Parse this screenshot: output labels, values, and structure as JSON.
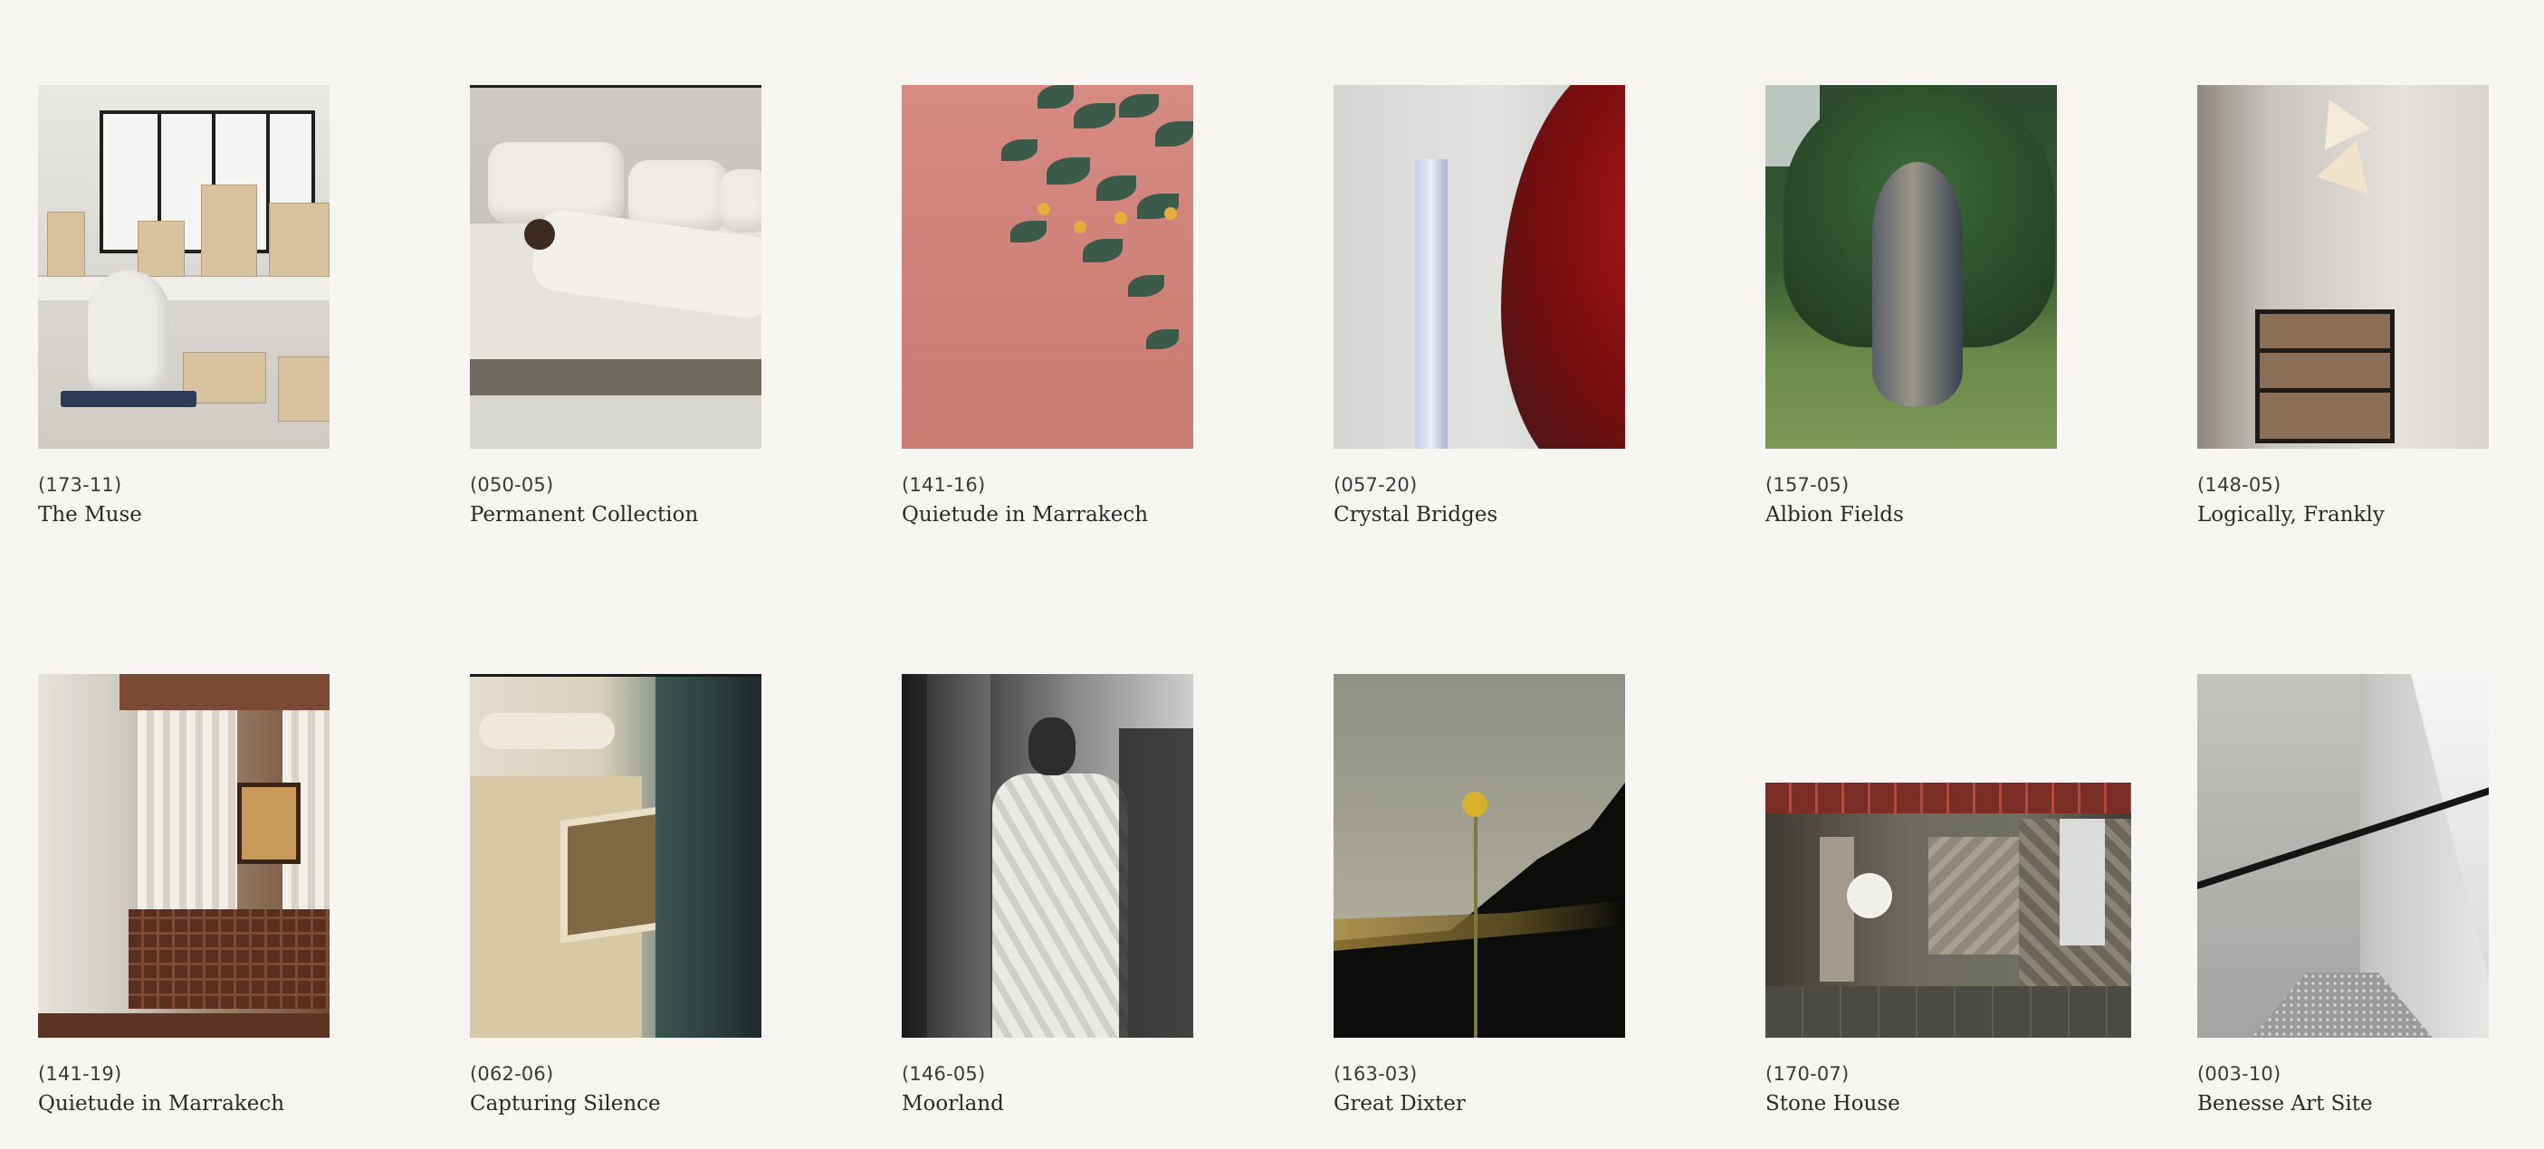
{
  "gallery": {
    "items": [
      {
        "code": "(173-11)",
        "title": "The Muse"
      },
      {
        "code": "(050-05)",
        "title": "Permanent Collection"
      },
      {
        "code": "(141-16)",
        "title": "Quietude in Marrakech"
      },
      {
        "code": "(057-20)",
        "title": "Crystal Bridges"
      },
      {
        "code": "(157-05)",
        "title": "Albion Fields"
      },
      {
        "code": "(148-05)",
        "title": "Logically, Frankly"
      },
      {
        "code": "(141-19)",
        "title": "Quietude in Marrakech"
      },
      {
        "code": "(062-06)",
        "title": "Capturing Silence"
      },
      {
        "code": "(146-05)",
        "title": "Moorland"
      },
      {
        "code": "(163-03)",
        "title": "Great Dixter"
      },
      {
        "code": "(170-07)",
        "title": "Stone House"
      },
      {
        "code": "(003-10)",
        "title": "Benesse Art Site"
      }
    ]
  }
}
